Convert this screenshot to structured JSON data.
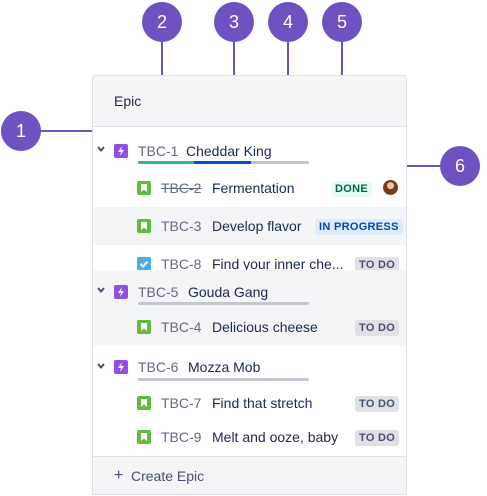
{
  "colors": {
    "callout": "#6e52c2",
    "epic_icon": "#904ee2",
    "story_icon": "#63ba3c",
    "task_icon": "#4bade8",
    "progress_done": "#36b37e",
    "progress_in_progress": "#0052cc",
    "progress_todo": "#c1c7d0"
  },
  "callouts": [
    "1",
    "2",
    "3",
    "4",
    "5",
    "6"
  ],
  "panel": {
    "header": "Epic",
    "create_label": "Create Epic"
  },
  "epics": [
    {
      "key": "TBC-1",
      "name": "Cheddar King",
      "progress": {
        "done": 0.33,
        "in_progress": 0.33,
        "todo": 0.34
      },
      "issues": [
        {
          "key": "TBC-2",
          "summary": "Fermentation",
          "status": "DONE",
          "type": "story-icon",
          "resolved": true
        },
        {
          "key": "TBC-3",
          "summary": "Develop flavor",
          "status": "IN PROGRESS",
          "type": "story-icon",
          "resolved": false
        },
        {
          "key": "TBC-8",
          "summary": "Find your inner che...",
          "status": "TO DO",
          "type": "task-icon",
          "resolved": false
        }
      ]
    },
    {
      "key": "TBC-5",
      "name": "Gouda Gang",
      "progress": {
        "done": 0,
        "in_progress": 0,
        "todo": 1
      },
      "issues": [
        {
          "key": "TBC-4",
          "summary": "Delicious cheese",
          "status": "TO DO",
          "type": "story-icon",
          "resolved": false
        }
      ]
    },
    {
      "key": "TBC-6",
      "name": "Mozza Mob",
      "progress": {
        "done": 0,
        "in_progress": 0,
        "todo": 1
      },
      "issues": [
        {
          "key": "TBC-7",
          "summary": "Find that stretch",
          "status": "TO DO",
          "type": "story-icon",
          "resolved": false
        },
        {
          "key": "TBC-9",
          "summary": "Melt and ooze, baby",
          "status": "TO DO",
          "type": "story-icon",
          "resolved": false
        }
      ]
    }
  ]
}
